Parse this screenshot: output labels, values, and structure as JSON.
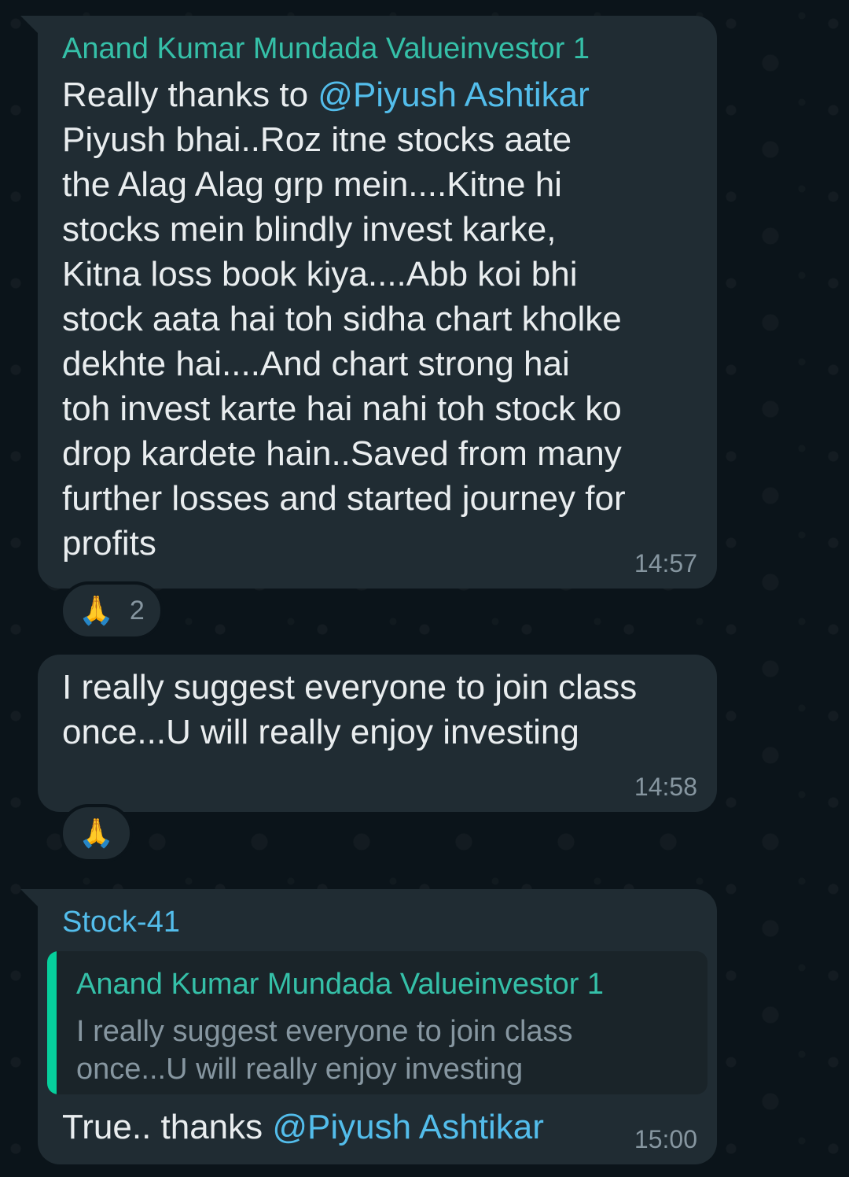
{
  "colors": {
    "background": "#0b141a",
    "bubble": "#202c33",
    "quote_background": "#1a2429",
    "quote_bar": "#06cf9c",
    "sender_teal": "#35c0a8",
    "sender_blue": "#53bdeb",
    "mention": "#53bdeb",
    "text": "#e9edef",
    "muted": "#8696a0"
  },
  "messages": [
    {
      "sender": "Anand Kumar Mundada Valueinvestor 1",
      "lines": [
        {
          "prefix": "Really thanks to ",
          "mention": "@Piyush Ashtikar"
        },
        {
          "text": "Piyush bhai..Roz itne stocks aate"
        },
        {
          "text": "the Alag Alag grp mein....Kitne hi"
        },
        {
          "text": "stocks mein blindly invest karke,"
        },
        {
          "text": "Kitna loss book kiya....Abb koi bhi"
        },
        {
          "text": "stock aata hai toh sidha chart kholke"
        },
        {
          "text": "dekhte hai....And chart strong hai"
        },
        {
          "text": "toh invest karte hai nahi toh stock ko"
        },
        {
          "text": "drop kardete hain..Saved from many"
        },
        {
          "text": "further losses and started  journey for"
        },
        {
          "text": "profits"
        }
      ],
      "time": "14:57",
      "reaction": {
        "emoji": "🙏",
        "count": "2"
      }
    },
    {
      "lines": [
        {
          "text": "I really suggest everyone to join class"
        },
        {
          "text": "once...U will really enjoy investing"
        }
      ],
      "time": "14:58",
      "reaction": {
        "emoji": "🙏"
      }
    },
    {
      "sender": "Stock-41",
      "quote": {
        "sender": "Anand Kumar Mundada Valueinvestor 1",
        "lines": [
          "I really suggest everyone to join class",
          "once...U will really enjoy investing"
        ]
      },
      "text_prefix": "True.. thanks ",
      "mention": "@Piyush Ashtikar",
      "time": "15:00"
    }
  ]
}
